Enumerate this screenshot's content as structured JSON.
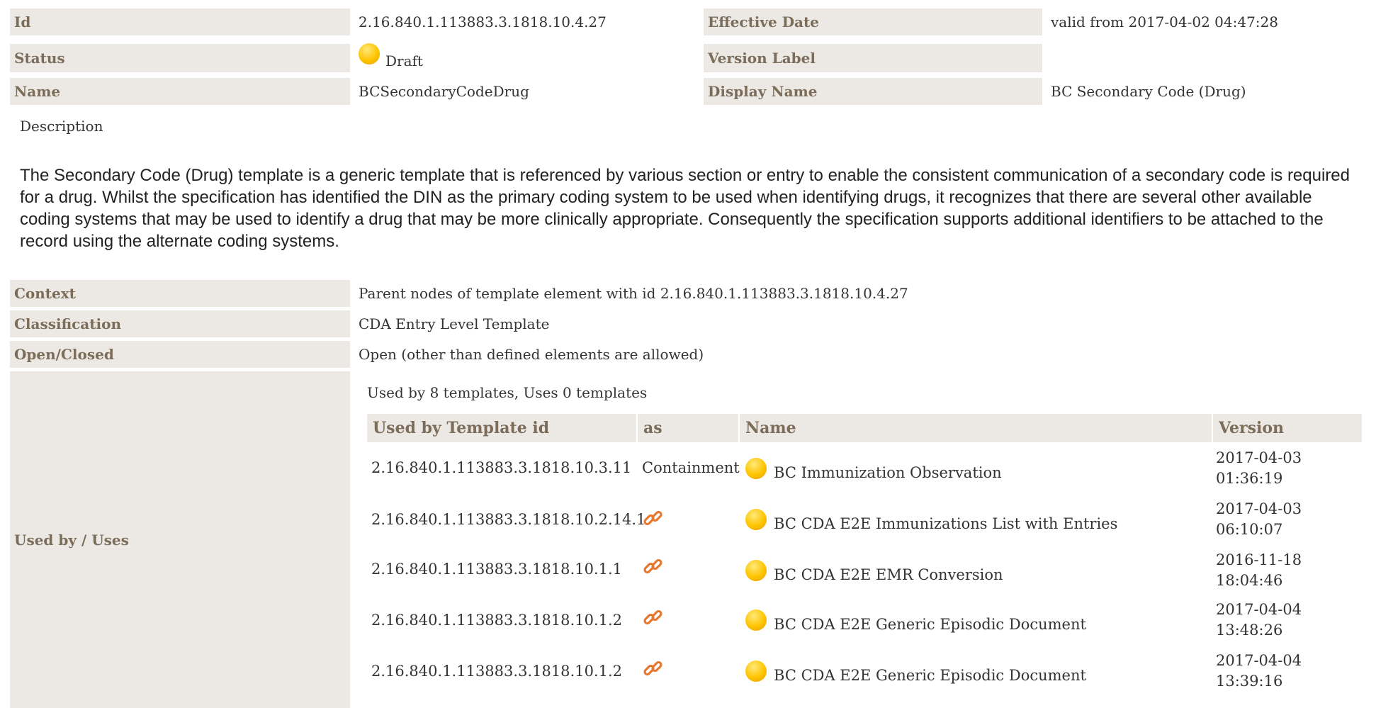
{
  "header": {
    "rows": [
      {
        "label1": "Id",
        "value1": "2.16.840.1.113883.3.1818.10.4.27",
        "label2": "Effective Date",
        "value2": "valid from 2017-04-02 04:47:28"
      },
      {
        "label1": "Status",
        "value1": "Draft",
        "label2": "Version Label",
        "value2": ""
      },
      {
        "label1": "Name",
        "value1": "BCSecondaryCodeDrug",
        "label2": "Display Name",
        "value2": "BC Secondary Code (Drug)"
      }
    ]
  },
  "description": {
    "label": "Description",
    "text": "The Secondary Code (Drug) template is a generic template that is referenced by various section or entry to enable the consistent communication of a secondary code is required for a drug. Whilst the specification has identified the DIN as the primary coding system to be used when identifying drugs, it recognizes that there are several other available coding systems that may be used to identify a drug that may be more clinically appropriate. Consequently the specification supports additional identifiers to be attached to the record using the alternate coding systems."
  },
  "details": [
    {
      "label": "Context",
      "value": "Parent nodes of template element with id 2.16.840.1.113883.3.1818.10.4.27"
    },
    {
      "label": "Classification",
      "value": "CDA Entry Level Template"
    },
    {
      "label": "Open/Closed",
      "value": "Open (other than defined elements are allowed)"
    }
  ],
  "usage": {
    "label": "Used by / Uses",
    "summary": "Used by 8 templates, Uses 0 templates",
    "columns": [
      "Used by Template id",
      "as",
      "Name",
      "Version"
    ],
    "rows": [
      {
        "id": "2.16.840.1.113883.3.1818.10.3.11",
        "as": "Containment",
        "name": "BC Immunization Observation",
        "date": "2017-04-03",
        "time": "01:36:19"
      },
      {
        "id": "2.16.840.1.113883.3.1818.10.2.14.1",
        "as": "",
        "name": "BC CDA E2E Immunizations List with Entries",
        "date": "2017-04-03",
        "time": "06:10:07"
      },
      {
        "id": "2.16.840.1.113883.3.1818.10.1.1",
        "as": "",
        "name": "BC CDA E2E EMR Conversion",
        "date": "2016-11-18",
        "time": "18:04:46"
      },
      {
        "id": "2.16.840.1.113883.3.1818.10.1.2",
        "as": "",
        "name": "BC CDA E2E Generic Episodic Document",
        "date": "2017-04-04",
        "time": "13:48:26"
      },
      {
        "id": "2.16.840.1.113883.3.1818.10.1.2",
        "as": "",
        "name": "BC CDA E2E Generic Episodic Document",
        "date": "2017-04-04",
        "time": "13:39:16"
      }
    ]
  },
  "icons": {
    "status": "draft-status-icon",
    "link": "link-icon"
  },
  "colors": {
    "label_bg": "#ece9e4",
    "label_text": "#7b6d59",
    "status_dot": "#ffc400",
    "link_icon": "#e8772e"
  }
}
